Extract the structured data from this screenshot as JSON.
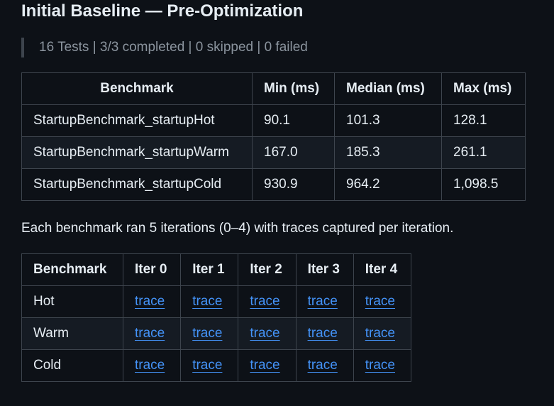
{
  "heading": "Initial Baseline — Pre-Optimization",
  "summary": "16 Tests | 3/3 completed | 0 skipped | 0 failed",
  "results_table": {
    "headers": [
      "Benchmark",
      "Min (ms)",
      "Median (ms)",
      "Max (ms)"
    ],
    "rows": [
      [
        "StartupBenchmark_startupHot",
        "90.1",
        "101.3",
        "128.1"
      ],
      [
        "StartupBenchmark_startupWarm",
        "167.0",
        "185.3",
        "261.1"
      ],
      [
        "StartupBenchmark_startupCold",
        "930.9",
        "964.2",
        "1,098.5"
      ]
    ]
  },
  "note": "Each benchmark ran 5 iterations (0–4) with traces captured per iteration.",
  "traces_table": {
    "headers": [
      "Benchmark",
      "Iter 0",
      "Iter 1",
      "Iter 2",
      "Iter 3",
      "Iter 4"
    ],
    "rows": [
      {
        "benchmark": "Hot",
        "links": [
          "trace",
          "trace",
          "trace",
          "trace",
          "trace"
        ]
      },
      {
        "benchmark": "Warm",
        "links": [
          "trace",
          "trace",
          "trace",
          "trace",
          "trace"
        ]
      },
      {
        "benchmark": "Cold",
        "links": [
          "trace",
          "trace",
          "trace",
          "trace",
          "trace"
        ]
      }
    ]
  },
  "colors": {
    "background": "#0d1117",
    "text": "#e6edf3",
    "muted": "#8b949e",
    "border": "#3d444d",
    "link": "#4493f8",
    "row_alt": "#151b23"
  }
}
